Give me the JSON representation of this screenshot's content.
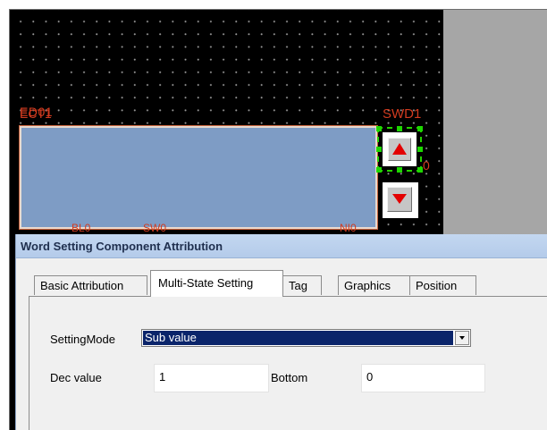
{
  "canvas": {
    "labels": {
      "overlap_top_a": "ECT1",
      "overlap_top_b": "ED01",
      "up_button_tag": "SWD1",
      "partial_digit": "0",
      "bottom_left": "BL0",
      "bottom_mid": "SW0",
      "bottom_right": "NI0"
    },
    "colors": {
      "canvas_bg": "#000000",
      "label_red": "#d23b1f",
      "display_fill": "#7e9cc5",
      "selection_green": "#25d200",
      "arrow_red": "#e30000"
    },
    "icons": {
      "up": "triangle-up-icon",
      "down": "triangle-down-icon"
    }
  },
  "dialog": {
    "title": "Word Setting Component Attribution",
    "tabs": [
      {
        "label": "Basic Attribution",
        "active": false
      },
      {
        "label": "Multi-State Setting",
        "active": true
      },
      {
        "label": "Tag",
        "active": false
      },
      {
        "label": "Graphics",
        "active": false
      },
      {
        "label": "Position",
        "active": false
      }
    ],
    "setting_mode": {
      "label": "SettingMode",
      "value": "Sub value"
    },
    "dec_value": {
      "label": "Dec value",
      "value": "1"
    },
    "bottom": {
      "label": "Bottom",
      "value": "0"
    }
  }
}
